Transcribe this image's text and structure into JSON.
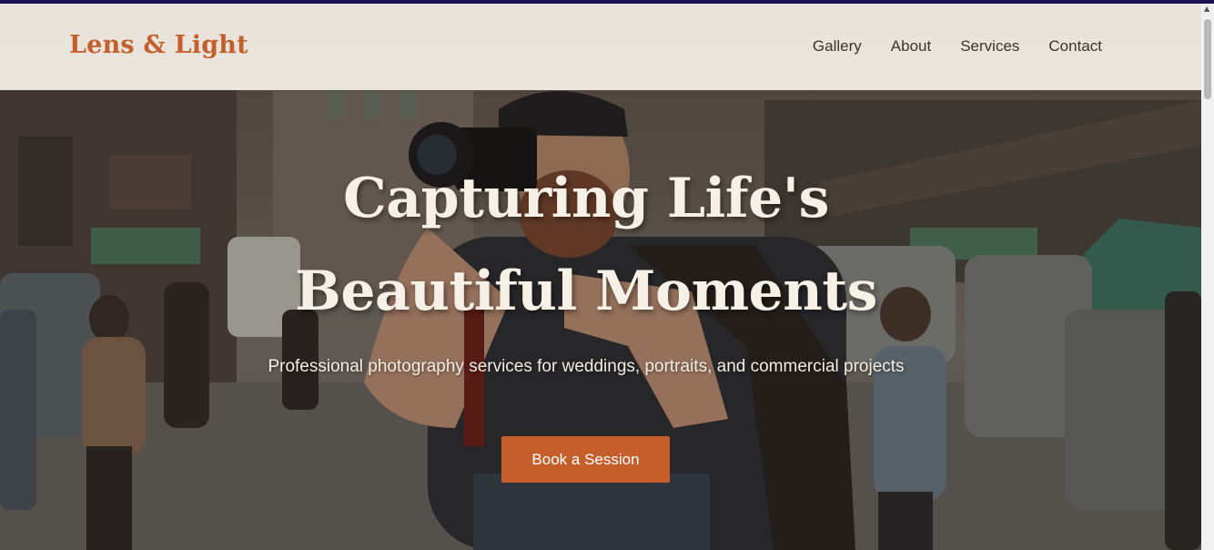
{
  "header": {
    "logo": "Lens & Light",
    "nav": [
      {
        "label": "Gallery"
      },
      {
        "label": "About"
      },
      {
        "label": "Services"
      },
      {
        "label": "Contact"
      }
    ]
  },
  "hero": {
    "title_line1": "Capturing Life's",
    "title_line2": "Beautiful Moments",
    "subtitle": "Professional photography services for weddings, portraits, and commercial projects",
    "cta_label": "Book a Session"
  },
  "colors": {
    "accent": "#c45f2c",
    "header_bg": "#f5f0e8",
    "title_text": "#f6f0e6",
    "nav_text": "#3b3532"
  },
  "icons": {
    "scroll_up": "scroll-up-arrow-icon"
  }
}
